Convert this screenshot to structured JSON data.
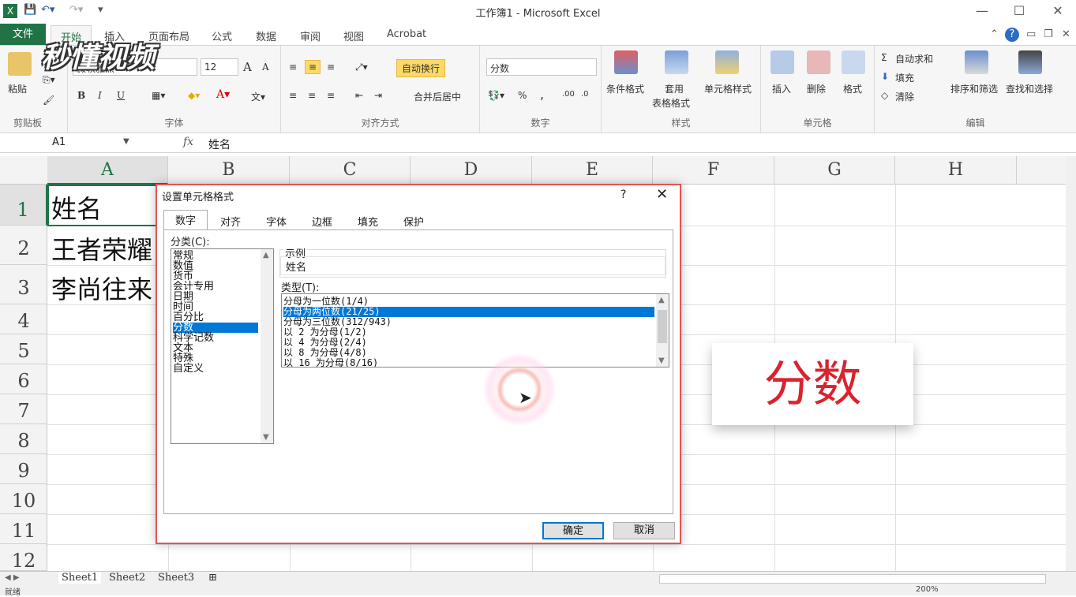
{
  "window": {
    "title": "工作簿1 - Microsoft Excel",
    "minimize": "—",
    "maximize": "☐",
    "close": "✕"
  },
  "ribbon_tabs": {
    "file": "文件",
    "items": [
      "开始",
      "插入",
      "页面布局",
      "公式",
      "数据",
      "审阅",
      "视图",
      "Acrobat"
    ]
  },
  "ribbon": {
    "clipboard": {
      "paste": "粘贴",
      "label": "剪贴板"
    },
    "font": {
      "name": "微软雅黑",
      "size": "12",
      "label": "字体",
      "bold": "B",
      "italic": "I",
      "underline": "U",
      "grow": "A",
      "shrink": "A"
    },
    "alignment": {
      "wrap": "自动换行",
      "merge": "合并后居中",
      "label": "对齐方式"
    },
    "number": {
      "format": "分数",
      "percent": "%",
      "comma": ",",
      "label": "数字"
    },
    "styles": {
      "conditional": "条件格式",
      "table1": "套用",
      "table2": "表格格式",
      "cell": "单元格样式",
      "label": "样式"
    },
    "cells": {
      "insert": "插入",
      "delete": "删除",
      "format": "格式",
      "label": "单元格"
    },
    "editing": {
      "autosum": "自动求和",
      "fill": "填充",
      "clear": "清除",
      "sort": "排序和筛选",
      "find": "查找和选择",
      "label": "编辑"
    }
  },
  "formula_bar": {
    "name_box": "A1",
    "fx": "fx",
    "content": "姓名"
  },
  "sheet": {
    "columns": [
      "A",
      "B",
      "C",
      "D",
      "E",
      "F",
      "G",
      "H"
    ],
    "rows": [
      "1",
      "2",
      "3",
      "4",
      "5",
      "6",
      "7",
      "8",
      "9",
      "10",
      "11",
      "12"
    ],
    "cells": {
      "A1": "姓名",
      "A2": "王者荣耀",
      "A3": "李尚往来"
    },
    "tabs": [
      "Sheet1",
      "Sheet2",
      "Sheet3"
    ]
  },
  "status": {
    "ready": "就绪",
    "zoom": "200%"
  },
  "dialog": {
    "title": "设置单元格格式",
    "help": "?",
    "close": "✕",
    "tabs": [
      "数字",
      "对齐",
      "字体",
      "边框",
      "填充",
      "保护"
    ],
    "category_label": "分类(C):",
    "categories": [
      "常规",
      "数值",
      "货币",
      "会计专用",
      "日期",
      "时间",
      "百分比",
      "分数",
      "科学记数",
      "文本",
      "特殊",
      "自定义"
    ],
    "selected_category": "分数",
    "sample_label": "示例",
    "sample_value": "姓名",
    "type_label": "类型(T):",
    "types": [
      "分母为一位数(1/4)",
      "分母为两位数(21/25)",
      "分母为三位数(312/943)",
      "以 2 为分母(1/2)",
      "以 4 为分母(2/4)",
      "以 8 为分母(4/8)",
      "以 16 为分母(8/16)"
    ],
    "selected_type": "分母为两位数(21/25)",
    "ok": "确定",
    "cancel": "取消"
  },
  "overlay": {
    "caption": "分数",
    "logo": "秒懂视频"
  },
  "colors": {
    "excel_green": "#217346",
    "selection_blue": "#0078d7",
    "caption_red": "#d9232e",
    "dialog_border": "#e05555"
  }
}
